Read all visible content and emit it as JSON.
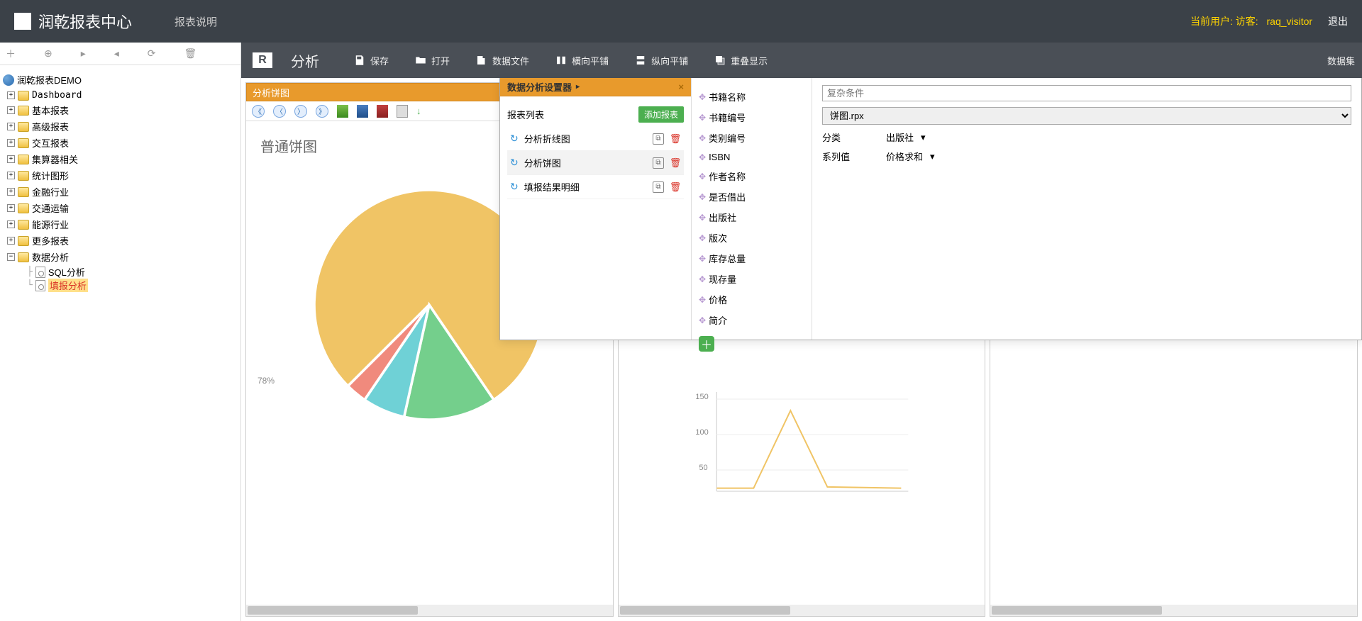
{
  "header": {
    "app_title": "润乾报表中心",
    "description_link": "报表说明",
    "current_user_label": "当前用户: 访客:",
    "user_name": "raq_visitor",
    "logout": "退出"
  },
  "sidebar": {
    "root": "润乾报表DEMO",
    "nodes": [
      {
        "label": "Dashboard"
      },
      {
        "label": "基本报表"
      },
      {
        "label": "高级报表"
      },
      {
        "label": "交互报表"
      },
      {
        "label": "集算器相关"
      },
      {
        "label": "统计图形"
      },
      {
        "label": "金融行业"
      },
      {
        "label": "交通运输"
      },
      {
        "label": "能源行业"
      },
      {
        "label": "更多报表"
      }
    ],
    "expanded_node": "数据分析",
    "leaves": [
      {
        "label": "SQL分析"
      },
      {
        "label": "填报分析",
        "active": true
      }
    ]
  },
  "analyze_toolbar": {
    "title": "分析",
    "buttons": [
      {
        "label": "保存"
      },
      {
        "label": "打开"
      },
      {
        "label": "数据文件"
      },
      {
        "label": "横向平铺"
      },
      {
        "label": "纵向平铺"
      },
      {
        "label": "重叠显示"
      }
    ],
    "dataset": "数据集"
  },
  "panels": [
    {
      "title": "分析饼图"
    },
    {
      "title": "分析折线图"
    },
    {
      "title": "填报结果明细"
    }
  ],
  "report_panel": {
    "chart_title": "普通饼图",
    "pie_label": "78%"
  },
  "popup": {
    "title": "数据分析设置器",
    "list_header": "报表列表",
    "add_report": "添加报表",
    "reports": [
      {
        "label": "分析折线图"
      },
      {
        "label": "分析饼图",
        "selected": true
      },
      {
        "label": "填报结果明细"
      }
    ],
    "fields": [
      "书籍名称",
      "书籍编号",
      "类别编号",
      "ISBN",
      "作者名称",
      "是否借出",
      "出版社",
      "版次",
      "库存总量",
      "现存量",
      "价格",
      "简介"
    ],
    "settings": {
      "complex_condition_label": "复杂条件",
      "complex_condition_value": "",
      "report_select": "饼图.rpx",
      "category_label": "分类",
      "category_value": "出版社",
      "series_label": "系列值",
      "series_value": "价格求和"
    }
  },
  "chart_data": [
    {
      "type": "pie",
      "title": "普通饼图",
      "series": [
        {
          "name": "slice_yellow",
          "value": 78,
          "color": "#f0c465"
        },
        {
          "name": "slice_green",
          "value": 13,
          "color": "#74cf8c"
        },
        {
          "name": "slice_teal",
          "value": 6,
          "color": "#6fd1d6"
        },
        {
          "name": "slice_red",
          "value": 3,
          "color": "#f08a7d"
        }
      ]
    },
    {
      "type": "line",
      "ylim": [
        0,
        160
      ],
      "yticks": [
        50,
        100,
        150
      ],
      "x": [
        0,
        1,
        2,
        3,
        4,
        5
      ],
      "values": [
        5,
        5,
        130,
        7,
        6,
        5
      ],
      "color": "#f0c465"
    }
  ]
}
